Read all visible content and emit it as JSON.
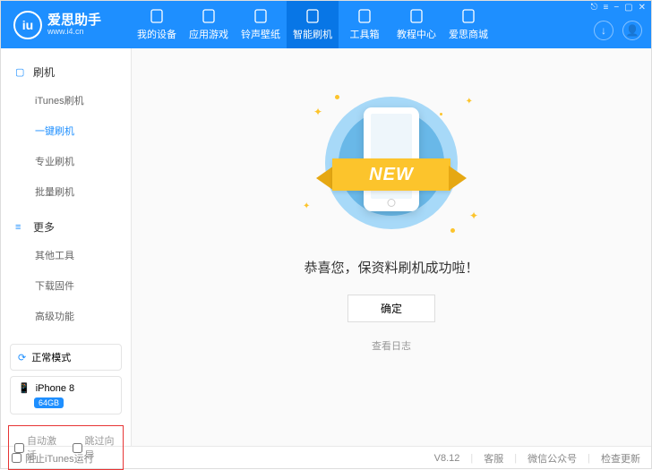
{
  "logo": {
    "badge": "iu",
    "title": "爱思助手",
    "sub": "www.i4.cn"
  },
  "nav": [
    {
      "label": "我的设备",
      "icon": "phone"
    },
    {
      "label": "应用游戏",
      "icon": "apps"
    },
    {
      "label": "铃声壁纸",
      "icon": "music"
    },
    {
      "label": "智能刷机",
      "icon": "flash",
      "active": true
    },
    {
      "label": "工具箱",
      "icon": "toolbox"
    },
    {
      "label": "教程中心",
      "icon": "book"
    },
    {
      "label": "爱思商城",
      "icon": "shop"
    }
  ],
  "win_icons": [
    "⎋",
    "≡",
    "−",
    "▢",
    "✕"
  ],
  "sidebar": {
    "sections": [
      {
        "title": "刷机",
        "icon": "▢",
        "items": [
          {
            "label": "iTunes刷机"
          },
          {
            "label": "一键刷机",
            "active": true
          },
          {
            "label": "专业刷机"
          },
          {
            "label": "批量刷机"
          }
        ]
      },
      {
        "title": "更多",
        "icon": "≡",
        "items": [
          {
            "label": "其他工具"
          },
          {
            "label": "下载固件"
          },
          {
            "label": "高级功能"
          }
        ]
      }
    ],
    "mode": {
      "label": "正常模式"
    },
    "device": {
      "name": "iPhone 8",
      "storage": "64GB"
    },
    "checkboxes": [
      {
        "label": "自动激活"
      },
      {
        "label": "跳过向导"
      }
    ]
  },
  "main": {
    "ribbon": "NEW",
    "success_text": "恭喜您，保资料刷机成功啦！",
    "ok": "确定",
    "view_log": "查看日志"
  },
  "footer": {
    "block_itunes": "阻止iTunes运行",
    "version": "V8.12",
    "links": [
      "客服",
      "微信公众号",
      "检查更新"
    ]
  }
}
